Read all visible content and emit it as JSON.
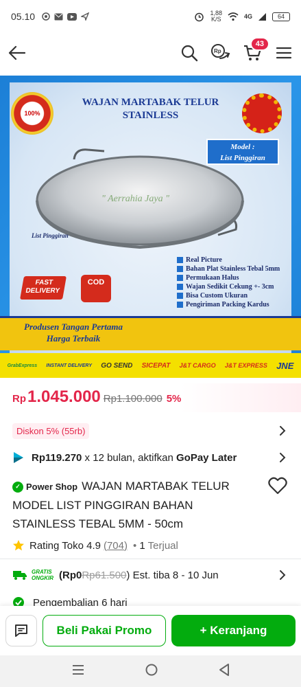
{
  "status_bar": {
    "time": "05.10",
    "net_speed": "1,88",
    "net_unit": "K/S",
    "network": "4G",
    "battery": "64"
  },
  "appbar": {
    "cart_count": "43"
  },
  "product_image": {
    "title_line1": "WAJAN MARTABAK TELUR",
    "title_line2": "STAINLESS",
    "seal_text": "100%",
    "model_label": "Model :",
    "model_value": "List Pinggiran",
    "watermark": "\" Aerrahia Jaya \"",
    "list_label": "List Pinggiran",
    "features": [
      "Real Picture",
      "Bahan Plat Stainless Tebal 5mm",
      "Permukaan Halus",
      "Wajan Sedikit Cekung +- 3cm",
      "Bisa Custom Ukuran",
      "Pengiriman Packing Kardus"
    ],
    "fast_delivery": "FAST DELIVERY",
    "cod": "COD",
    "banner_line1": "Produsen Tangan Pertama",
    "banner_line2": "Harga Terbaik",
    "couriers": [
      "GrabExpress",
      "INSTANT DELIVERY",
      "GO SEND",
      "SICEPAT",
      "J&T CARGO",
      "J&T EXPRESS",
      "JNE"
    ]
  },
  "price": {
    "currency": "Rp",
    "current": "1.045.000",
    "original": "Rp1.100.000",
    "discount": "5%"
  },
  "discount_chip": "Diskon 5% (55rb)",
  "gopay": {
    "amount": "Rp119.270",
    "text": " x 12 bulan, aktifkan ",
    "brand": "GoPay Later"
  },
  "product": {
    "badge": "Power Shop",
    "title": "WAJAN MARTABAK TELUR MODEL LIST PINGGIRAN BAHAN STAINLESS TEBAL 5MM - 50cm"
  },
  "rating": {
    "label": "Rating Toko 4.9",
    "count": "(704)",
    "sold_prefix": "• ",
    "sold_count": "1",
    "sold_label": " Terjual"
  },
  "shipping": {
    "badge_line1": "GRATIS",
    "badge_line2": "ONGKIR",
    "free_prefix": "(Rp0",
    "old_price": "Rp61.500",
    "eta": ") Est. tiba 8 - 10 Jun"
  },
  "returns": {
    "label": "Pengembalian 6 hari"
  },
  "actions": {
    "promo": "Beli Pakai Promo",
    "cart": "+ Keranjang"
  },
  "colors": {
    "primary_green": "#03ac0e",
    "price_red": "#e3264a"
  }
}
